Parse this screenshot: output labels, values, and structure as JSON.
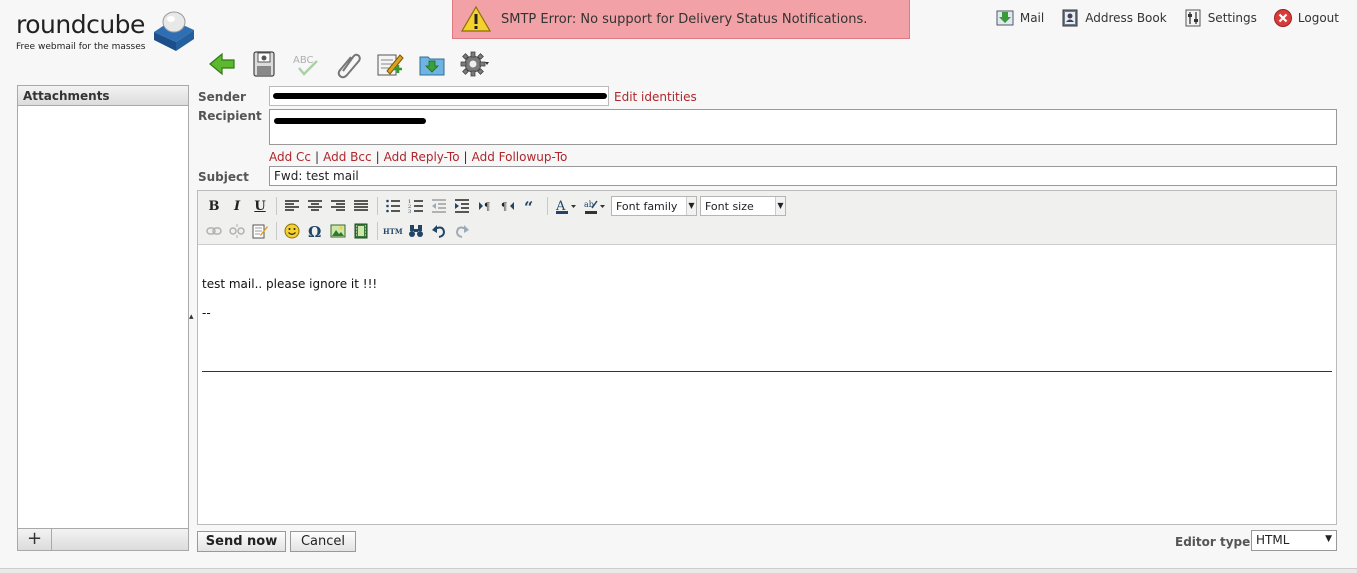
{
  "logo": {
    "name": "roundcube",
    "tagline": "Free webmail for the masses"
  },
  "error": {
    "message": "SMTP Error: No support for Delivery Status Notifications."
  },
  "topnav": {
    "mail": "Mail",
    "address_book": "Address Book",
    "settings": "Settings",
    "logout": "Logout"
  },
  "toolbar": {
    "icons": [
      "back-icon",
      "save-draft-icon",
      "spellcheck-icon",
      "attach-icon",
      "signature-icon",
      "archive-icon",
      "options-icon"
    ]
  },
  "attachments": {
    "header": "Attachments",
    "add_label": "+"
  },
  "form": {
    "sender_label": "Sender",
    "edit_identities": "Edit identities",
    "recipient_label": "Recipient",
    "add_cc": "Add Cc",
    "add_bcc": "Add Bcc",
    "add_reply_to": "Add Reply-To",
    "add_followup_to": "Add Followup-To",
    "subject_label": "Subject",
    "subject_value": "Fwd: test mail"
  },
  "editor": {
    "font_family": "Font family",
    "font_size": "Font size",
    "body_line1": "test mail.. please ignore it  !!!",
    "body_line2": "--"
  },
  "footer": {
    "send": "Send now",
    "cancel": "Cancel",
    "editor_type_label": "Editor type",
    "editor_type_value": "HTML"
  },
  "colors": {
    "error_bg": "#f2a2a6",
    "link": "#b0262b"
  }
}
